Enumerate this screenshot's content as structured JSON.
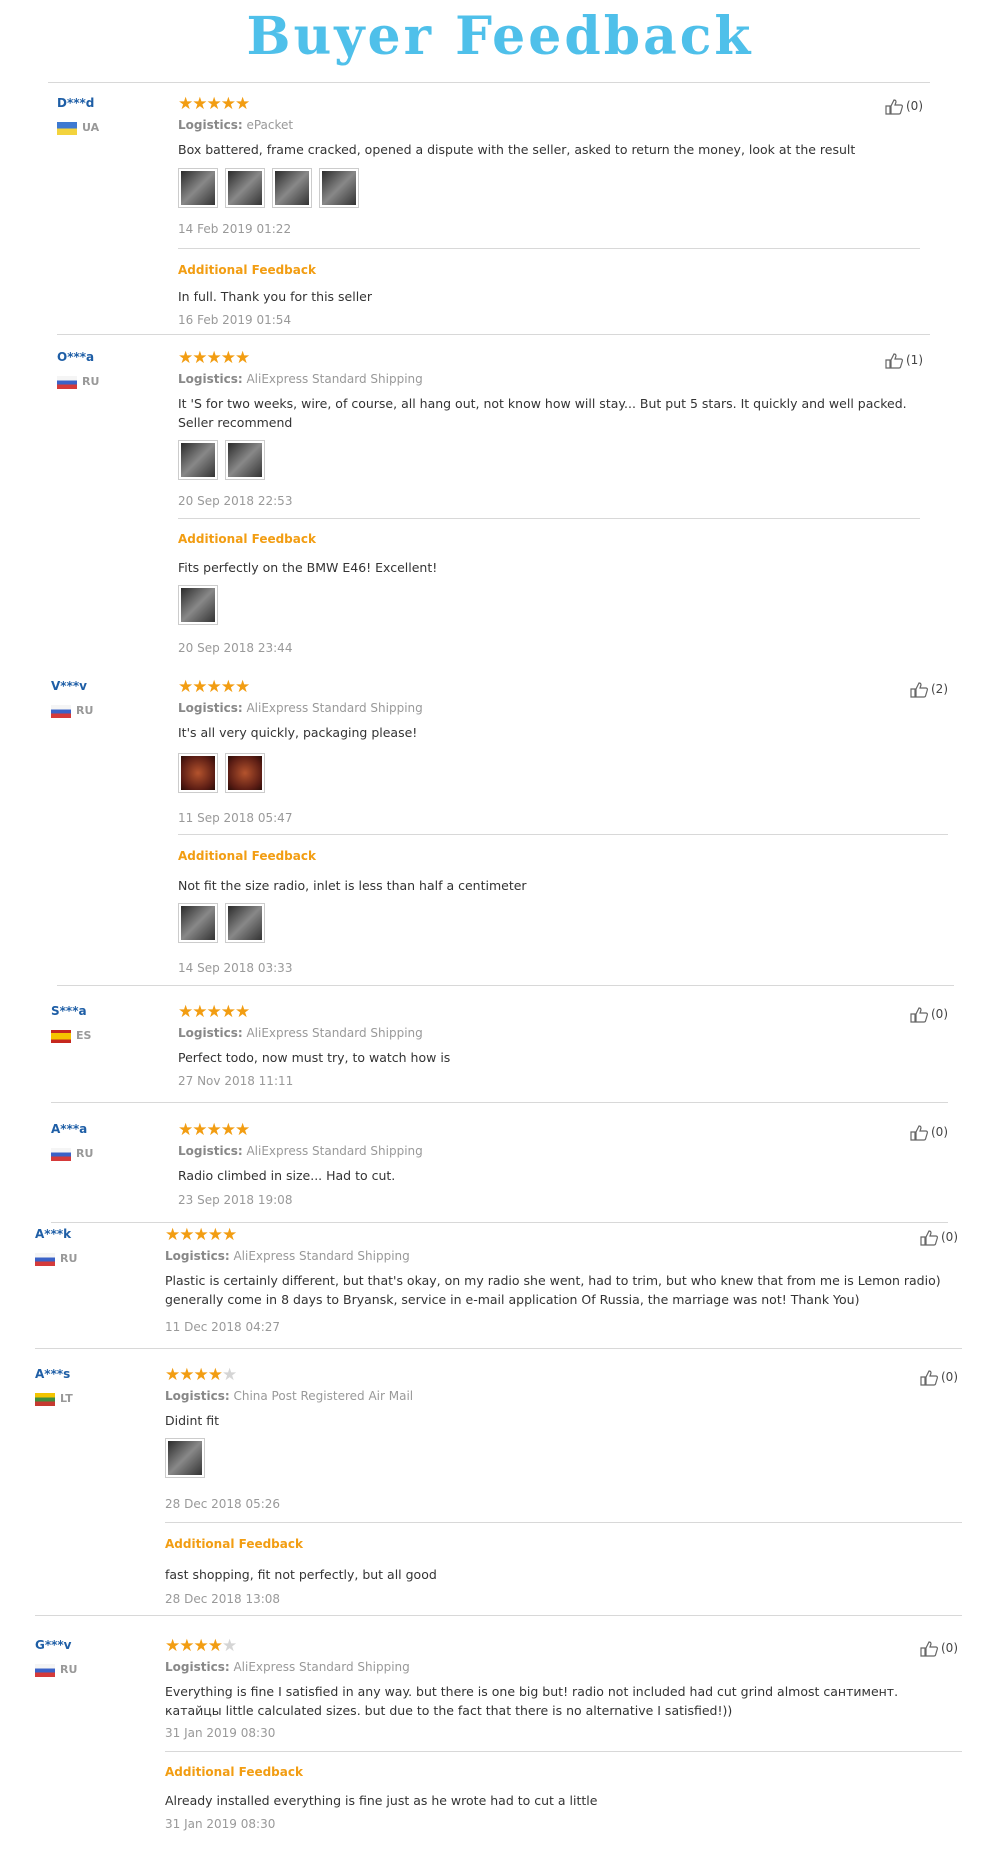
{
  "title": "Buyer Feedback",
  "labels": {
    "logistics": "Logistics:",
    "additional": "Additional Feedback"
  },
  "colors": {
    "title": "#4fc0ea",
    "accent": "#f29d12",
    "username": "#1e5ea6"
  },
  "reviews": [
    {
      "user": "D***d",
      "country": "UA",
      "stars": 5,
      "logistics": "ePacket",
      "comment": "Box battered, frame cracked, opened a dispute with the seller, asked to return the money, look at the result",
      "photos": 4,
      "date": "14 Feb 2019 01:22",
      "helpful": "(0)",
      "additional": {
        "comment": "In full. Thank you for this seller",
        "date": "16 Feb 2019 01:54"
      }
    },
    {
      "user": "O***a",
      "country": "RU",
      "stars": 5,
      "logistics": "AliExpress Standard Shipping",
      "comment": "It 'S for two weeks, wire, of course, all hang out, not know how will stay... But put 5 stars. It quickly and well packed. Seller recommend",
      "photos": 2,
      "date": "20 Sep 2018 22:53",
      "helpful": "(1)",
      "additional": {
        "comment": "Fits perfectly on the BMW E46! Excellent!",
        "photos": 1,
        "date": "20 Sep 2018 23:44"
      }
    },
    {
      "user": "V***v",
      "country": "RU",
      "stars": 5,
      "logistics": "AliExpress Standard Shipping",
      "comment": "It's all very quickly, packaging please!",
      "photos": 2,
      "date": "11 Sep 2018 05:47",
      "helpful": "(2)",
      "additional": {
        "comment": "Not fit the size radio, inlet is less than half a centimeter",
        "photos": 2,
        "date": "14 Sep 2018 03:33"
      }
    },
    {
      "user": "S***a",
      "country": "ES",
      "stars": 5,
      "logistics": "AliExpress Standard Shipping",
      "comment": "Perfect todo, now must try, to watch how is",
      "date": "27 Nov 2018 11:11",
      "helpful": "(0)"
    },
    {
      "user": "A***a",
      "country": "RU",
      "stars": 5,
      "logistics": "AliExpress Standard Shipping",
      "comment": "Radio climbed in size... Had to cut.",
      "date": "23 Sep 2018 19:08",
      "helpful": "(0)"
    },
    {
      "user": "A***k",
      "country": "RU",
      "stars": 5,
      "logistics": "AliExpress Standard Shipping",
      "comment": "Plastic is certainly different, but that's okay, on my radio she went, had to trim, but who knew that from me is Lemon radio) generally come in 8 days to Bryansk, service in e-mail application Of Russia, the marriage was not! Thank You)",
      "date": "11 Dec 2018 04:27",
      "helpful": "(0)"
    },
    {
      "user": "A***s",
      "country": "LT",
      "stars": 4,
      "logistics": "China Post Registered Air Mail",
      "comment": "Didint fit",
      "photos": 1,
      "date": "28 Dec 2018 05:26",
      "helpful": "(0)",
      "additional": {
        "comment": "fast shopping, fit not perfectly, but all good",
        "date": "28 Dec 2018 13:08"
      }
    },
    {
      "user": "G***v",
      "country": "RU",
      "stars": 4,
      "logistics": "AliExpress Standard Shipping",
      "comment": "Everything is fine I satisfied in any way. but there is one big but! radio not included had cut grind almost сантимент. катайцы little calculated sizes. but due to the fact that there is no alternative I satisfied!))",
      "date": "31 Jan 2019 08:30",
      "helpful": "(0)",
      "additional": {
        "comment": "Already installed everything is fine just as he wrote had to cut a little",
        "date": "31 Jan 2019 08:30"
      }
    }
  ]
}
